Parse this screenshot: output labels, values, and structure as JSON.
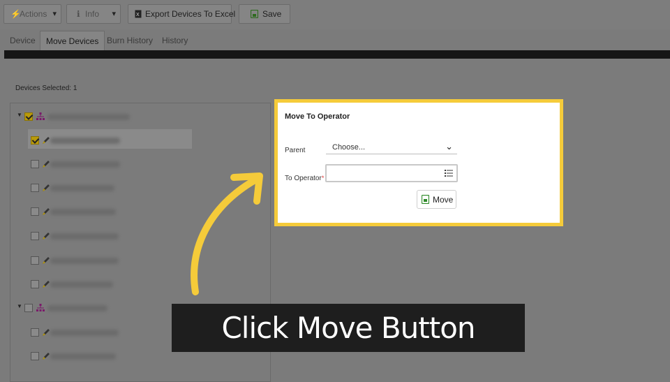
{
  "toolbar": {
    "actions_label": "Actions",
    "info_label": "Info",
    "export_label": "Export Devices To Excel",
    "save_label": "Save"
  },
  "tabs": [
    {
      "label": "Device"
    },
    {
      "label": "Move Devices"
    },
    {
      "label": "Burn History"
    },
    {
      "label": "History"
    }
  ],
  "left_panel": {
    "devices_selected": "Devices Selected: 1"
  },
  "dialog": {
    "title": "Move To Operator",
    "parent_label": "Parent",
    "parent_value": "Choose...",
    "operator_label": "To Operator",
    "required_mark": "*",
    "operator_value": "",
    "move_label": "Move"
  },
  "caption": "Click Move Button",
  "colors": {
    "highlight_border": "#f5cb3a",
    "arrow": "#f5cb3a",
    "checkbox_checked": "#b99a0a",
    "org_icon": "#7a1a6a",
    "caption_bg": "#1e1e1e"
  }
}
